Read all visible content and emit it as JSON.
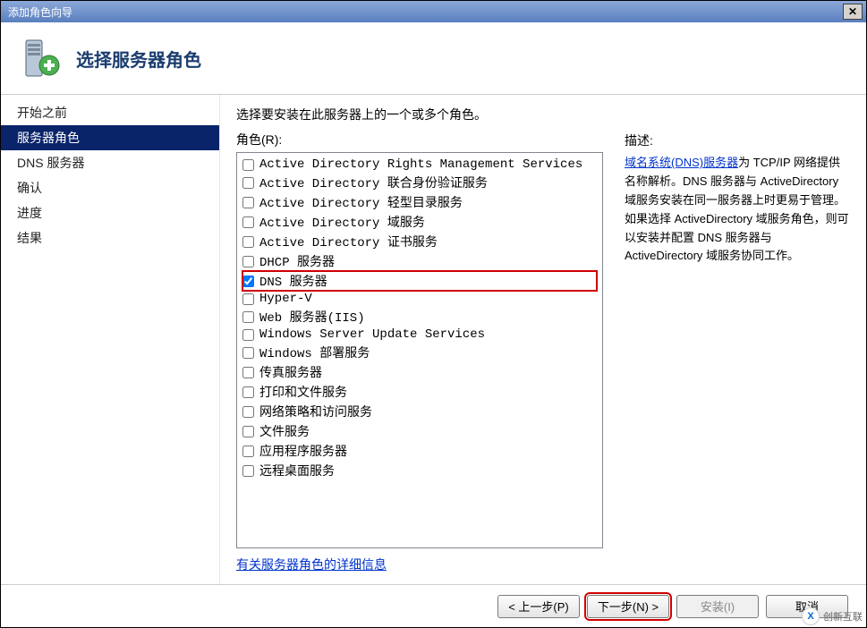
{
  "window": {
    "title": "添加角色向导",
    "close": "✕"
  },
  "header": {
    "title": "选择服务器角色"
  },
  "sidebar": {
    "items": [
      {
        "label": "开始之前",
        "selected": false
      },
      {
        "label": "服务器角色",
        "selected": true
      },
      {
        "label": "DNS 服务器",
        "selected": false
      },
      {
        "label": "确认",
        "selected": false
      },
      {
        "label": "进度",
        "selected": false
      },
      {
        "label": "结果",
        "selected": false
      }
    ]
  },
  "main": {
    "instruction": "选择要安装在此服务器上的一个或多个角色。",
    "roles_label": "角色(R):",
    "desc_label": "描述:",
    "roles": [
      {
        "label": "Active Directory Rights Management Services",
        "checked": false,
        "highlighted": false
      },
      {
        "label": "Active Directory 联合身份验证服务",
        "checked": false,
        "highlighted": false
      },
      {
        "label": "Active Directory 轻型目录服务",
        "checked": false,
        "highlighted": false
      },
      {
        "label": "Active Directory 域服务",
        "checked": false,
        "highlighted": false
      },
      {
        "label": "Active Directory 证书服务",
        "checked": false,
        "highlighted": false
      },
      {
        "label": "DHCP 服务器",
        "checked": false,
        "highlighted": false
      },
      {
        "label": "DNS 服务器",
        "checked": true,
        "highlighted": true
      },
      {
        "label": "Hyper-V",
        "checked": false,
        "highlighted": false
      },
      {
        "label": "Web 服务器(IIS)",
        "checked": false,
        "highlighted": false
      },
      {
        "label": "Windows Server Update Services",
        "checked": false,
        "highlighted": false
      },
      {
        "label": "Windows 部署服务",
        "checked": false,
        "highlighted": false
      },
      {
        "label": "传真服务器",
        "checked": false,
        "highlighted": false
      },
      {
        "label": "打印和文件服务",
        "checked": false,
        "highlighted": false
      },
      {
        "label": "网络策略和访问服务",
        "checked": false,
        "highlighted": false
      },
      {
        "label": "文件服务",
        "checked": false,
        "highlighted": false
      },
      {
        "label": "应用程序服务器",
        "checked": false,
        "highlighted": false
      },
      {
        "label": "远程桌面服务",
        "checked": false,
        "highlighted": false
      }
    ],
    "more_link": "有关服务器角色的详细信息",
    "description": {
      "link_text": "域名系统(DNS)服务器",
      "rest": "为 TCP/IP 网络提供名称解析。DNS 服务器与 ActiveDirectory 域服务安装在同一服务器上时更易于管理。如果选择 ActiveDirectory 域服务角色，则可以安装并配置 DNS 服务器与 ActiveDirectory 域服务协同工作。"
    }
  },
  "footer": {
    "prev": "< 上一步(P)",
    "next": "下一步(N) >",
    "install": "安装(I)",
    "cancel": "取消"
  },
  "watermark": {
    "text": "创新互联"
  }
}
